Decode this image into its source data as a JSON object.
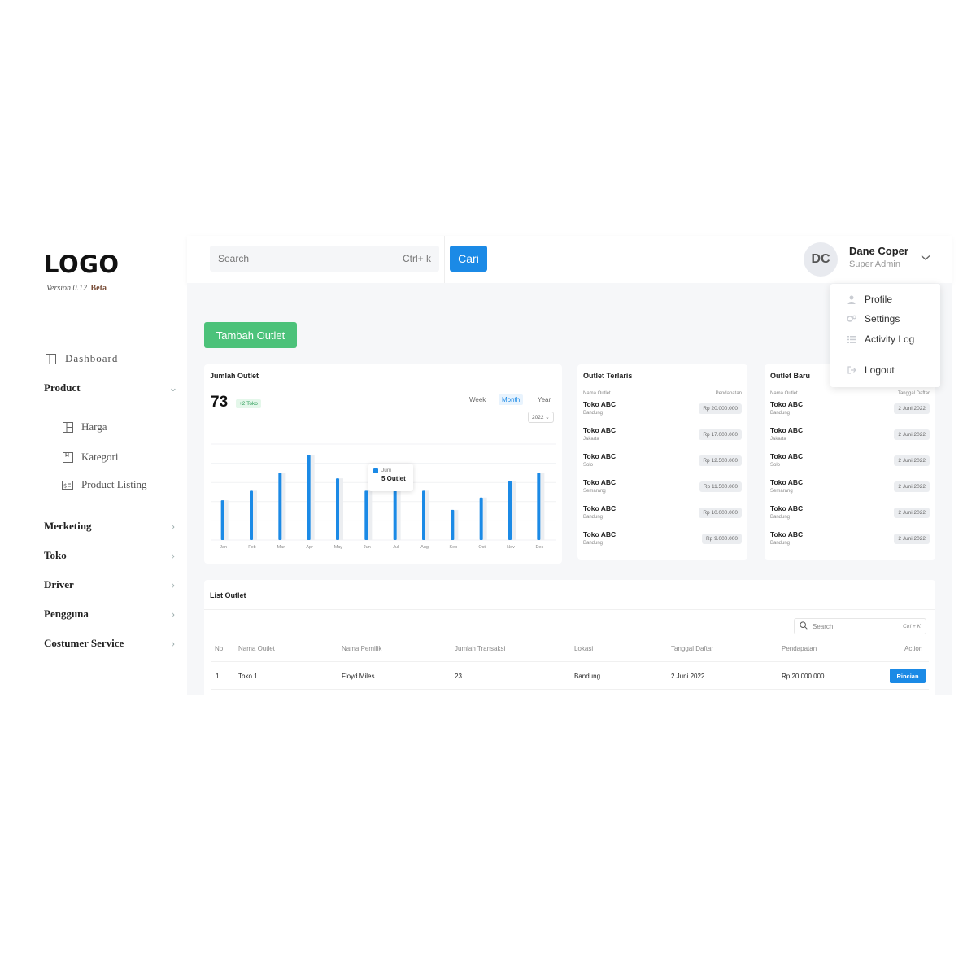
{
  "brand": {
    "logo": "LOGO",
    "version": "Version 0.12",
    "beta": "Beta"
  },
  "sidebar": {
    "dashboard": "Dashboard",
    "product": "Product",
    "sub": [
      "Harga",
      "Kategori",
      "Product Listing"
    ],
    "items": [
      "Merketing",
      "Toko",
      "Driver",
      "Pengguna",
      "Costumer Service"
    ]
  },
  "topbar": {
    "search_placeholder": "Search",
    "search_shortcut": "Ctrl+ k",
    "search_button": "Cari",
    "user_initials": "DC",
    "user_name": "Dane Coper",
    "user_role": "Super Admin"
  },
  "user_menu": [
    "Profile",
    "Settings",
    "Activity Log",
    "Logout"
  ],
  "actions": {
    "add_outlet": "Tambah Outlet"
  },
  "outlet_chart": {
    "title": "Jumlah Outlet",
    "total": "73",
    "delta": "+2 Toko",
    "periods": [
      "Week",
      "Month",
      "Year"
    ],
    "active_period": "Month",
    "year": "2022",
    "tooltip_label": "Juni",
    "tooltip_value": "5 Outlet"
  },
  "chart_data": {
    "type": "bar",
    "categories": [
      "Jan",
      "Feb",
      "Mar",
      "Apr",
      "May",
      "Jun",
      "Jul",
      "Aug",
      "Sep",
      "Oct",
      "Nov",
      "Des"
    ],
    "series": [
      {
        "values": [
          29,
          36,
          49,
          62,
          45,
          36,
          36,
          36,
          22,
          31,
          43,
          49
        ]
      },
      {
        "values": [
          29,
          36,
          49,
          62,
          45,
          36,
          36,
          36,
          22,
          31,
          43,
          49
        ]
      }
    ],
    "ylim": [
      0,
      70
    ],
    "grid": true,
    "colors": [
      "#1b8ae6",
      "#eceef1"
    ]
  },
  "top_outlets": {
    "title": "Outlet Terlaris",
    "col_name": "Nama Outlet",
    "col_value": "Pendapatan",
    "rows": [
      {
        "name": "Toko ABC",
        "city": "Bandung",
        "value": "Rp 20.000.000"
      },
      {
        "name": "Toko ABC",
        "city": "Jakarta",
        "value": "Rp 17.000.000"
      },
      {
        "name": "Toko ABC",
        "city": "Solo",
        "value": "Rp 12.500.000"
      },
      {
        "name": "Toko ABC",
        "city": "Semarang",
        "value": "Rp 11.500.000"
      },
      {
        "name": "Toko ABC",
        "city": "Bandung",
        "value": "Rp 10.000.000"
      },
      {
        "name": "Toko ABC",
        "city": "Bandung",
        "value": "Rp 9.000.000"
      }
    ]
  },
  "new_outlets": {
    "title": "Outlet Baru",
    "col_name": "Nama Outlet",
    "col_value": "Tanggal Daftar",
    "rows": [
      {
        "name": "Toko ABC",
        "city": "Bandung",
        "value": "2 Juni 2022"
      },
      {
        "name": "Toko ABC",
        "city": "Jakarta",
        "value": "2 Juni 2022"
      },
      {
        "name": "Toko ABC",
        "city": "Solo",
        "value": "2 Juni 2022"
      },
      {
        "name": "Toko ABC",
        "city": "Semarang",
        "value": "2 Juni 2022"
      },
      {
        "name": "Toko ABC",
        "city": "Bandung",
        "value": "2 Juni 2022"
      },
      {
        "name": "Toko ABC",
        "city": "Bandung",
        "value": "2 Juni 2022"
      }
    ]
  },
  "outlet_table": {
    "title": "List Outlet",
    "search_placeholder": "Search",
    "search_shortcut": "Ctrl + K",
    "headers": [
      "No",
      "Nama Outlet",
      "Nama Pemilik",
      "Jumlah Transaksi",
      "Lokasi",
      "Tanggal Daftar",
      "Pendapatan",
      "Action"
    ],
    "rows": [
      {
        "no": "1",
        "outlet": "Toko 1",
        "owner": "Floyd Miles",
        "transactions": "23",
        "location": "Bandung",
        "date": "2 Juni 2022",
        "revenue": "Rp 20.000.000",
        "action": "Rincian"
      }
    ]
  }
}
